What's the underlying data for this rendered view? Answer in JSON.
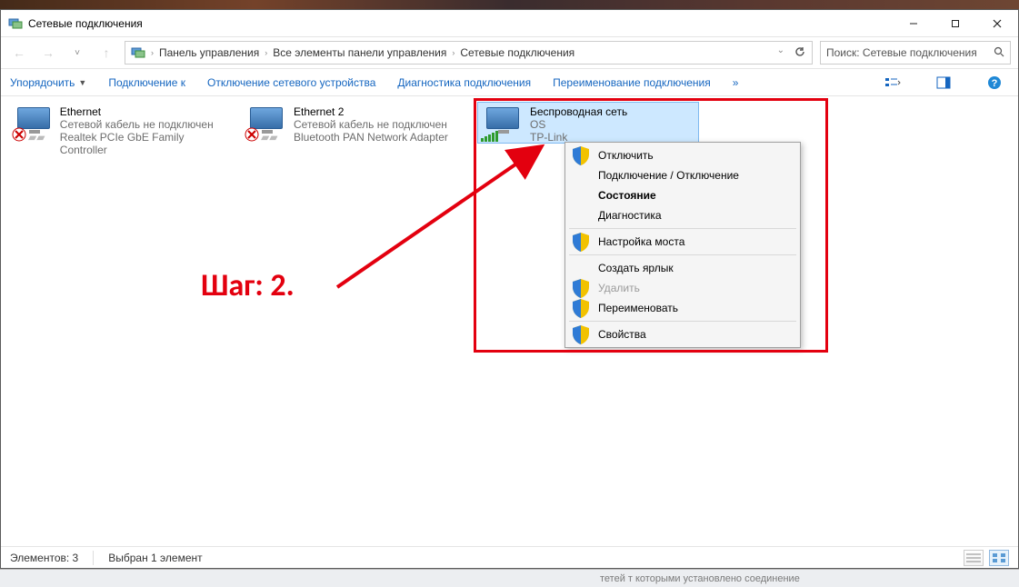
{
  "titlebar": {
    "title": "Сетевые подключения"
  },
  "breadcrumbs": {
    "seg1": "Панель управления",
    "seg2": "Все элементы панели управления",
    "seg3": "Сетевые подключения"
  },
  "search": {
    "placeholder": "Поиск: Сетевые подключения"
  },
  "toolbar": {
    "organize": "Упорядочить",
    "connect": "Подключение к",
    "disable": "Отключение сетевого устройства",
    "diagnose": "Диагностика подключения",
    "rename": "Переименование подключения",
    "overflow": "»"
  },
  "connections": [
    {
      "name": "Ethernet",
      "status": "Сетевой кабель не подключен",
      "adapter": "Realtek PCIe GbE Family Controller",
      "disconnected": true
    },
    {
      "name": "Ethernet 2",
      "status": "Сетевой кабель не подключен",
      "adapter": "Bluetooth PAN Network Adapter",
      "disconnected": true
    },
    {
      "name": "Беспроводная сеть",
      "status": "OS",
      "adapter": "TP-Link",
      "disconnected": false,
      "selected": true
    }
  ],
  "context_menu": {
    "disconnect": "Отключить",
    "connect_disconnect": "Подключение / Отключение",
    "status": "Состояние",
    "diagnose": "Диагностика",
    "bridge": "Настройка моста",
    "shortcut": "Создать ярлык",
    "delete": "Удалить",
    "rename": "Переименовать",
    "properties": "Свойства"
  },
  "annotation": {
    "step_label": "Шаг: 2."
  },
  "statusbar": {
    "count": "Элементов: 3",
    "selected": "Выбран 1 элемент"
  },
  "bottom_garble": "тетей т которыми установлено соединение"
}
